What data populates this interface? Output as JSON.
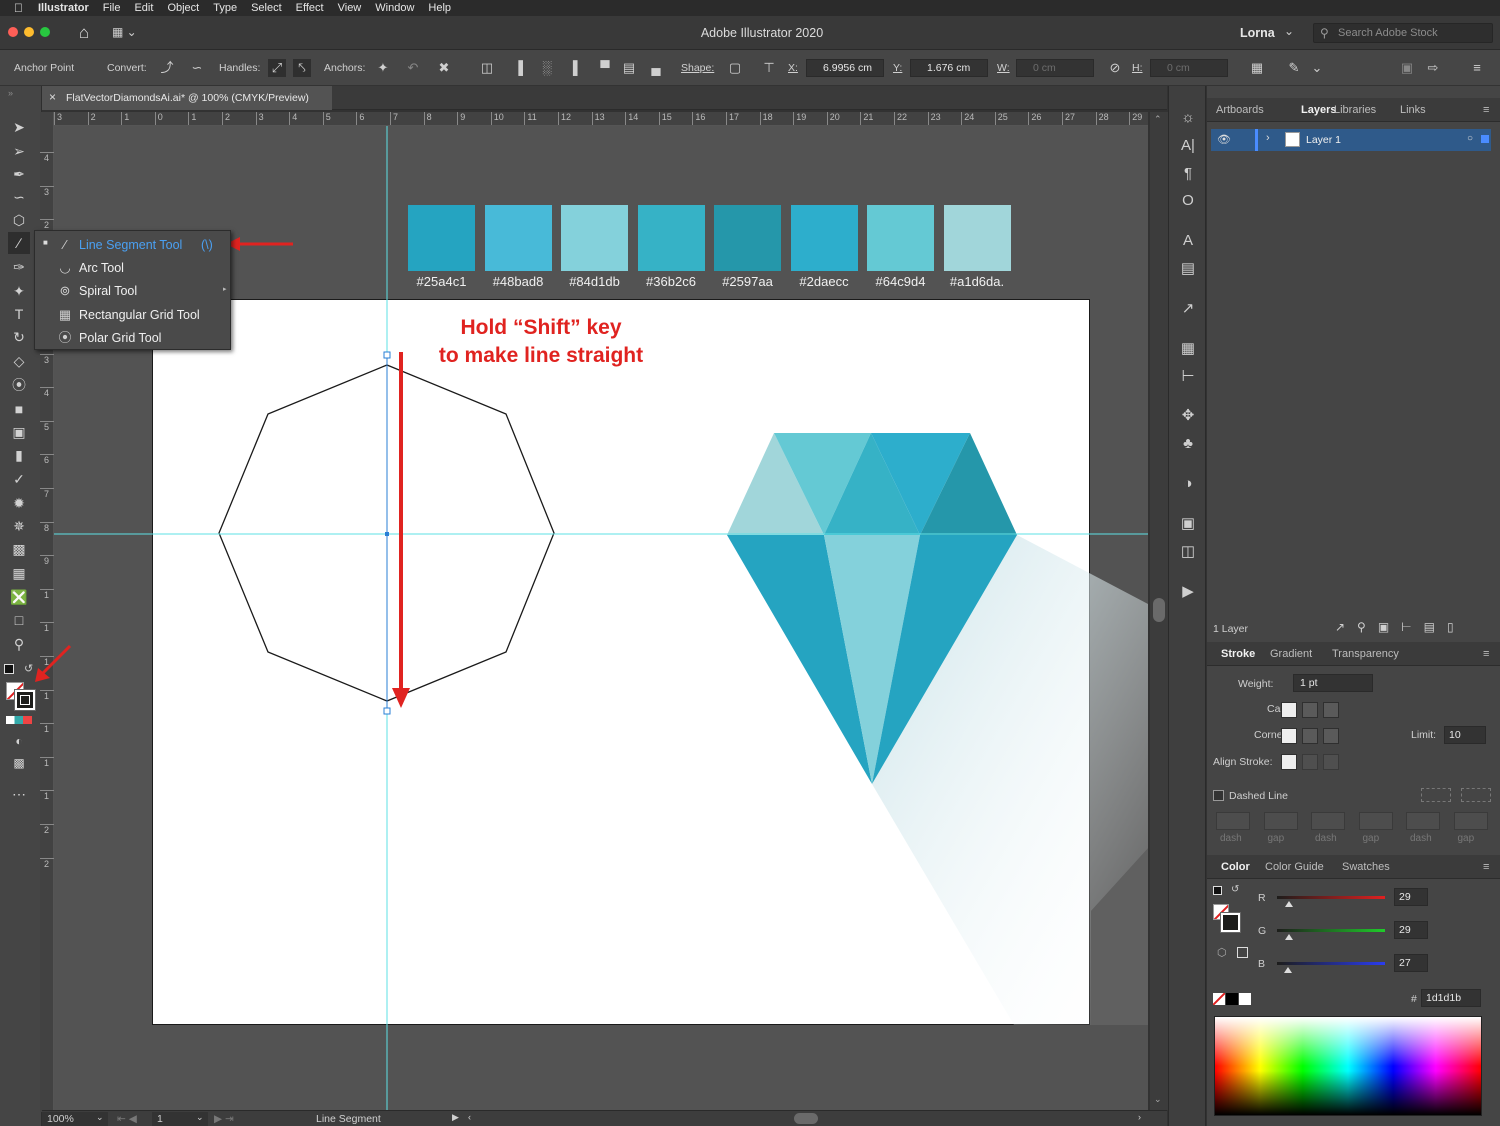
{
  "menu": {
    "app_name": "Illustrator",
    "items": [
      "File",
      "Edit",
      "Object",
      "Type",
      "Select",
      "Effect",
      "View",
      "Window",
      "Help"
    ]
  },
  "titlebar": {
    "title": "Adobe Illustrator 2020",
    "user": "Lorna",
    "search_placeholder": "Search Adobe Stock"
  },
  "control": {
    "tool_label": "Anchor Point",
    "convert": "Convert:",
    "handles": "Handles:",
    "anchors": "Anchors:",
    "shape": "Shape:",
    "x_label": "X:",
    "x_value": "6.9956 cm",
    "y_label": "Y:",
    "y_value": "1.676 cm",
    "w_label": "W:",
    "w_value": "0 cm",
    "h_label": "H:",
    "h_value": "0 cm"
  },
  "document": {
    "tab_title": "FlatVectorDiamondsAi.ai* @ 100% (CMYK/Preview)"
  },
  "ruler": {
    "h_ticks": [
      "3",
      "2",
      "1",
      "0",
      "1",
      "2",
      "3",
      "4",
      "5",
      "6",
      "7",
      "8",
      "9",
      "10",
      "11",
      "12",
      "13",
      "14",
      "15",
      "16",
      "17",
      "18",
      "19",
      "20",
      "21",
      "22",
      "23",
      "24",
      "25",
      "26",
      "27",
      "28",
      "29"
    ],
    "v_ticks": [
      "4",
      "3",
      "2",
      "1",
      "1",
      "2",
      "3",
      "4",
      "5",
      "6",
      "7",
      "8",
      "9",
      "1",
      "1",
      "1",
      "1",
      "1",
      "1",
      "1",
      "2",
      "2"
    ]
  },
  "swatches": [
    {
      "color": "#25a4c1",
      "label": "#25a4c1"
    },
    {
      "color": "#48bad8",
      "label": "#48bad8"
    },
    {
      "color": "#84d1db",
      "label": "#84d1db"
    },
    {
      "color": "#36b2c6",
      "label": "#36b2c6"
    },
    {
      "color": "#2597aa",
      "label": "#2597aa"
    },
    {
      "color": "#2daecc",
      "label": "#2daecc"
    },
    {
      "color": "#64c9d4",
      "label": "#64c9d4"
    },
    {
      "color": "#a1d6da",
      "label": "#a1d6da."
    }
  ],
  "annotation": {
    "line1": "Hold “Shift” key",
    "line2": "to make line straight",
    "color": "#e02320"
  },
  "flyout": {
    "items": [
      {
        "label": "Line Segment Tool",
        "shortcut": "(\\)",
        "icon": "line-segment-icon",
        "active": true
      },
      {
        "label": "Arc Tool",
        "icon": "arc-icon"
      },
      {
        "label": "Spiral Tool",
        "icon": "spiral-icon"
      },
      {
        "label": "Rectangular Grid Tool",
        "icon": "rect-grid-icon"
      },
      {
        "label": "Polar Grid Tool",
        "icon": "polar-grid-icon"
      }
    ]
  },
  "status": {
    "zoom": "100%",
    "artboard_num": "1",
    "tool_name": "Line Segment"
  },
  "layers_panel": {
    "tabs": [
      "Artboards",
      "Layers",
      "Libraries",
      "Links"
    ],
    "active_tab": "Layers",
    "layer_name": "Layer 1",
    "footer": "1 Layer"
  },
  "stroke_panel": {
    "tabs": [
      "Stroke",
      "Gradient",
      "Transparency"
    ],
    "weight_label": "Weight:",
    "weight_value": "1 pt",
    "cap_label": "Cap:",
    "corner_label": "Corner:",
    "limit_label": "Limit:",
    "limit_value": "10",
    "align_label": "Align Stroke:",
    "dashed_label": "Dashed Line",
    "dash_labels": [
      "dash",
      "gap",
      "dash",
      "gap",
      "dash",
      "gap"
    ]
  },
  "color_panel": {
    "tabs": [
      "Color",
      "Color Guide",
      "Swatches"
    ],
    "r_label": "R",
    "r_value": "29",
    "g_label": "G",
    "g_value": "29",
    "b_label": "B",
    "b_value": "27",
    "hex_label": "#",
    "hex_value": "1d1d1b"
  }
}
